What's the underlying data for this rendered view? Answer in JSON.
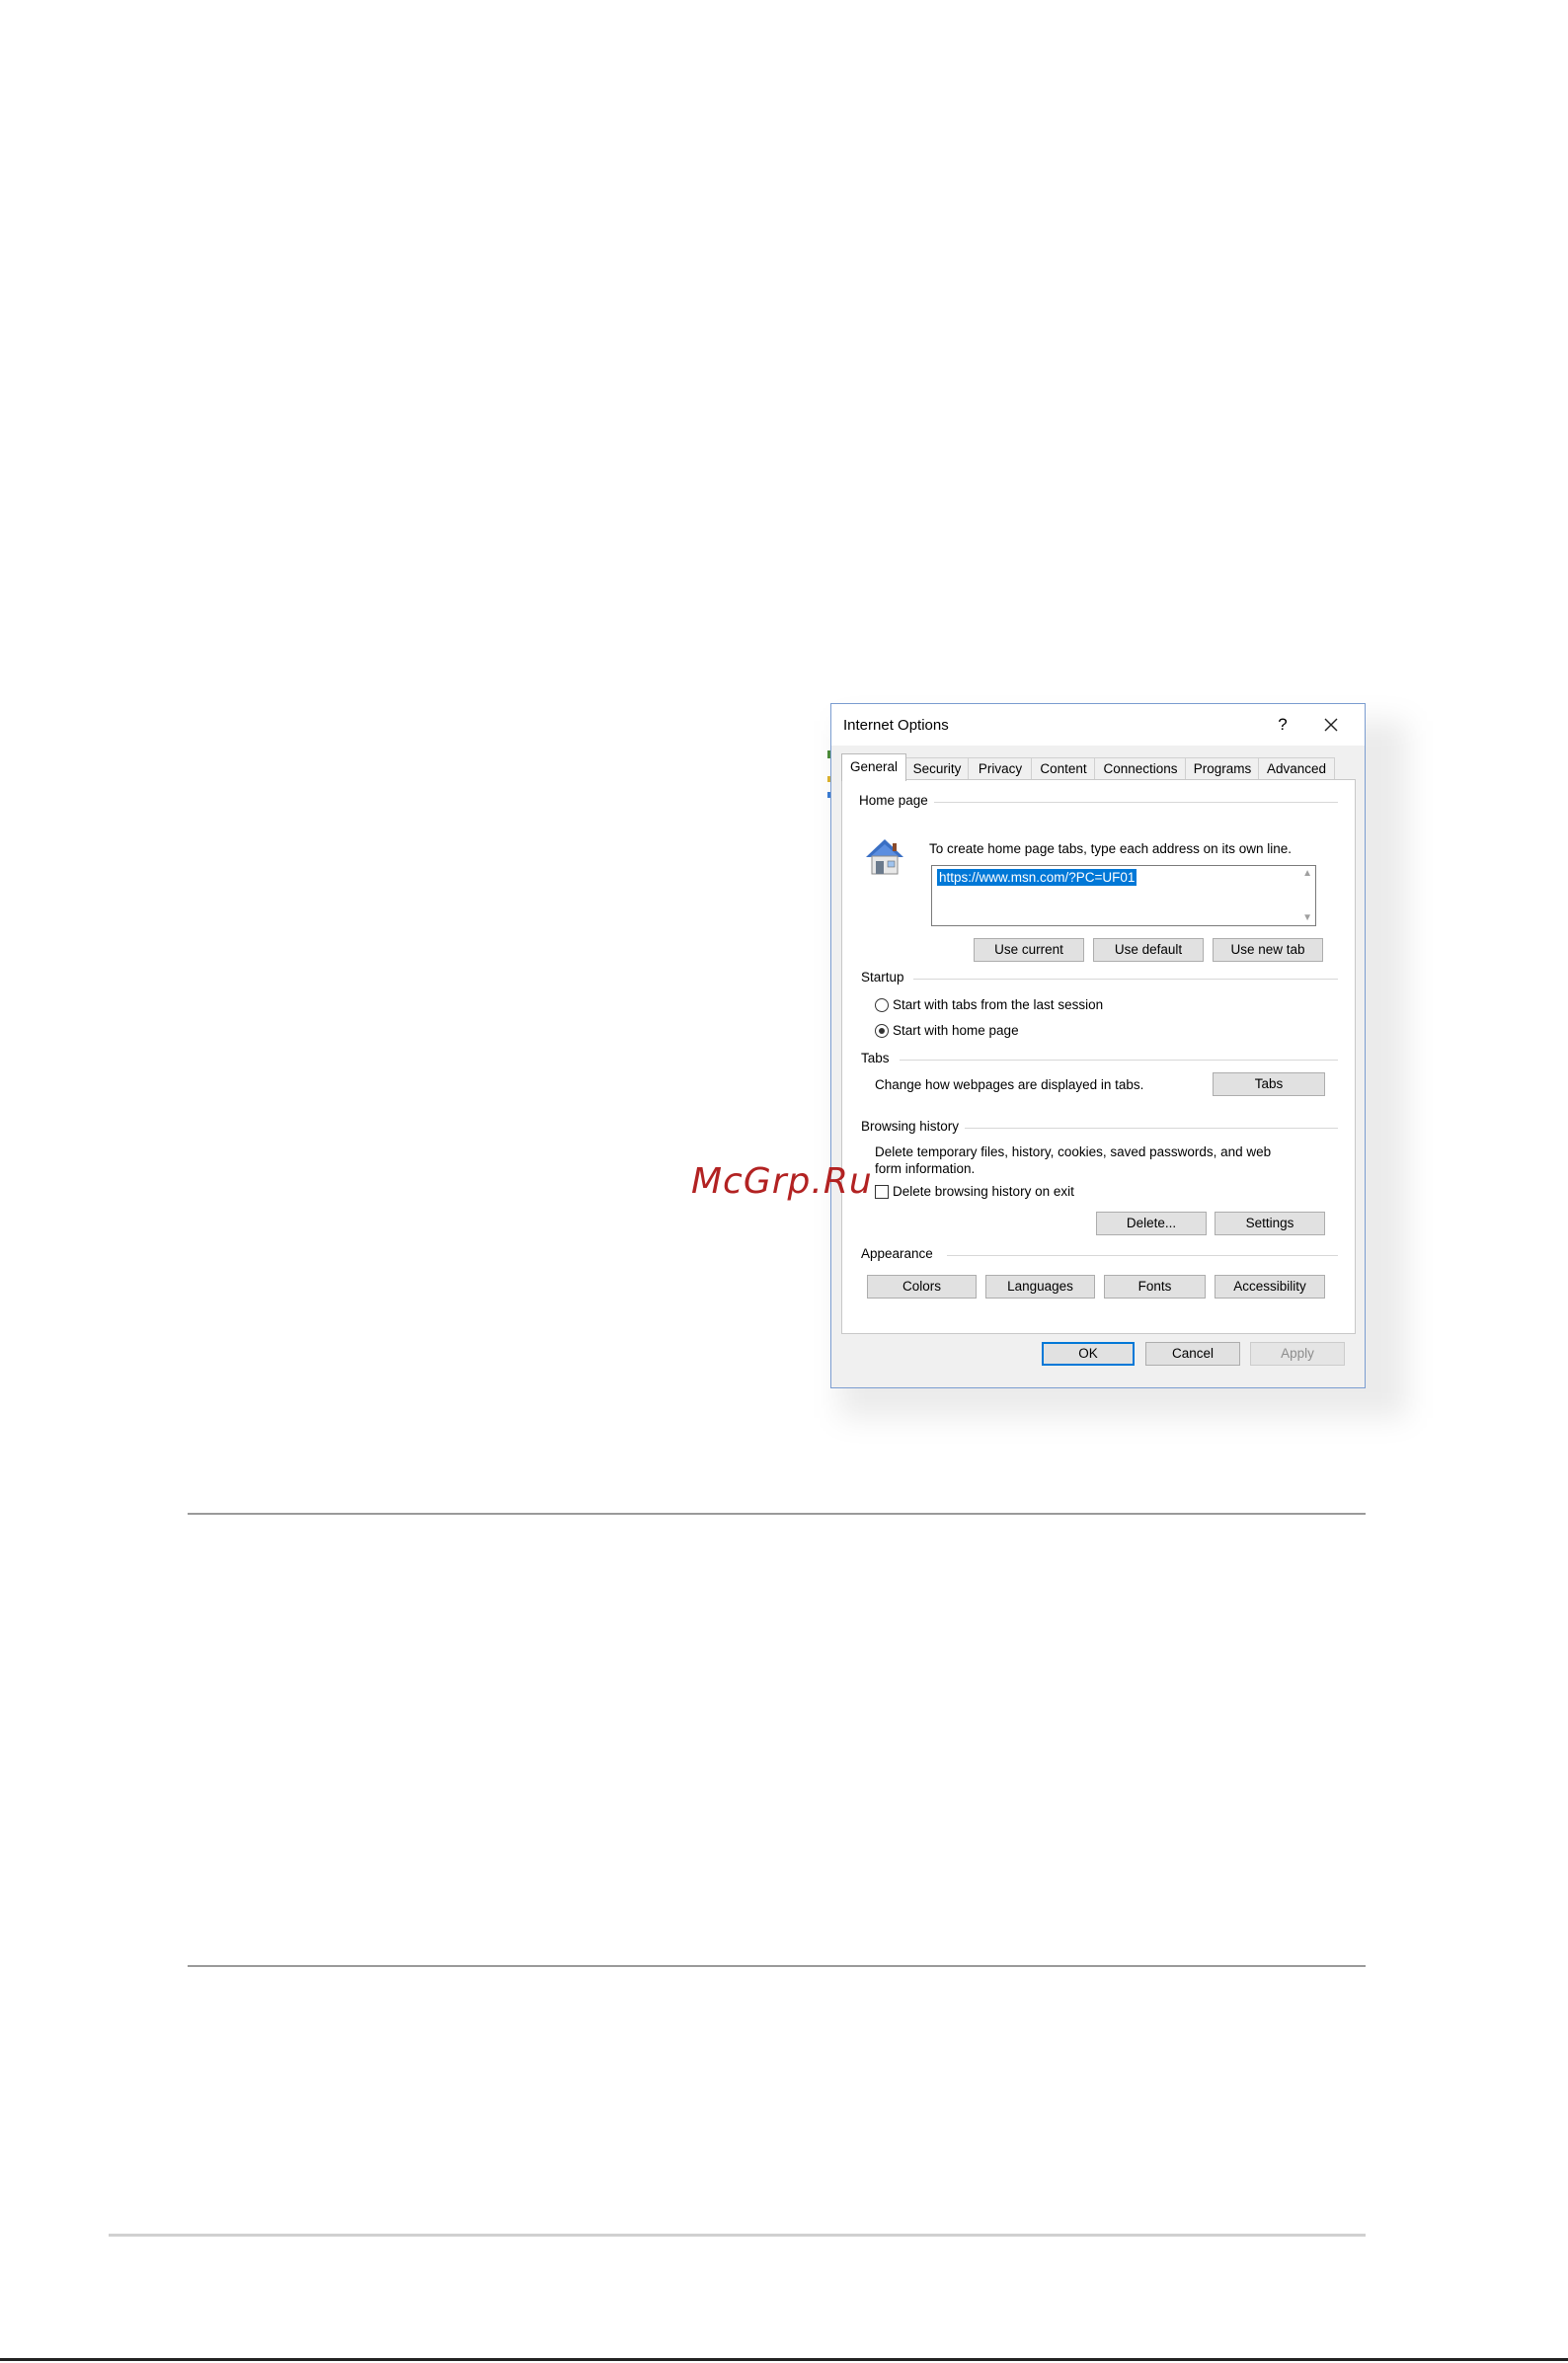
{
  "watermark": "McGrp.Ru",
  "dialog": {
    "title": "Internet Options",
    "help_label": "?",
    "tabs": [
      "General",
      "Security",
      "Privacy",
      "Content",
      "Connections",
      "Programs",
      "Advanced"
    ],
    "active_tab": "General",
    "home_page": {
      "heading": "Home page",
      "instruction": "To create home page tabs, type each address on its own line.",
      "url_value": "https://www.msn.com/?PC=UF01",
      "buttons": {
        "use_current": "Use current",
        "use_default": "Use default",
        "use_new_tab": "Use new tab"
      }
    },
    "startup": {
      "heading": "Startup",
      "option_last_session": "Start with tabs from the last session",
      "option_home_page": "Start with home page",
      "selected": "Start with home page"
    },
    "tabs_group": {
      "heading": "Tabs",
      "description": "Change how webpages are displayed in tabs.",
      "button": "Tabs"
    },
    "browsing_history": {
      "heading": "Browsing history",
      "description_line1": "Delete temporary files, history, cookies, saved passwords, and web",
      "description_line2": "form information.",
      "checkbox_label": "Delete browsing history on exit",
      "checkbox_checked": false,
      "delete_button": "Delete...",
      "settings_button": "Settings"
    },
    "appearance": {
      "heading": "Appearance",
      "buttons": {
        "colors": "Colors",
        "languages": "Languages",
        "fonts": "Fonts",
        "accessibility": "Accessibility"
      }
    },
    "footer": {
      "ok": "OK",
      "cancel": "Cancel",
      "apply": "Apply"
    }
  },
  "colors": {
    "selection": "#0078d7",
    "watermark": "#b22222"
  }
}
